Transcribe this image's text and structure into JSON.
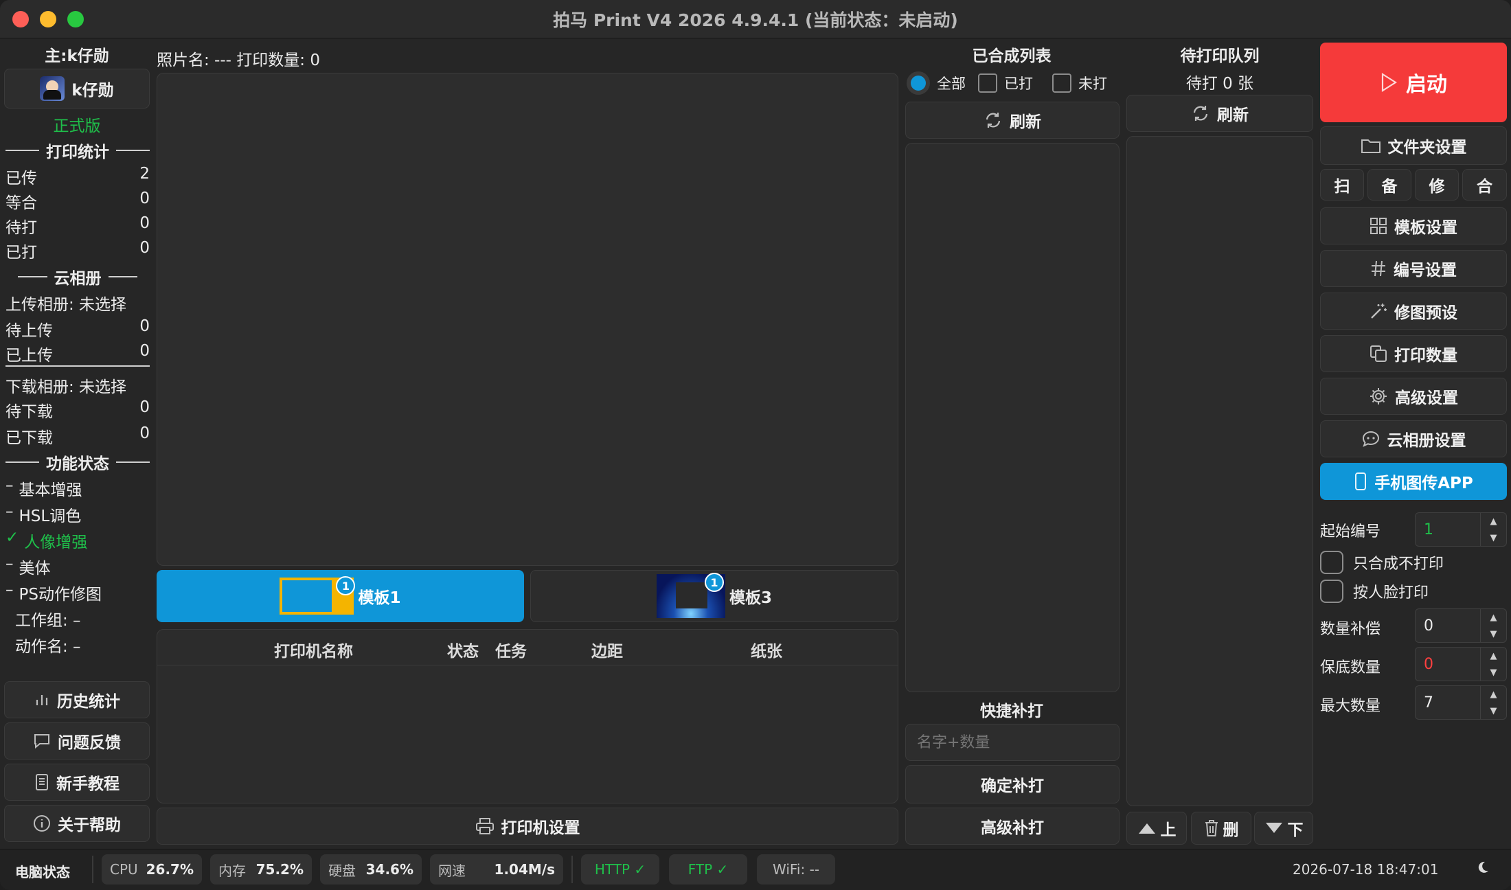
{
  "window": {
    "title": "拍马 Print V4 2026  4.9.4.1 (当前状态：未启动)"
  },
  "left": {
    "host": "主:k仔勋",
    "user_name": "k仔勋",
    "edition": "正式版",
    "print_stats_title": "打印统计",
    "print_stats": [
      {
        "label": "已传",
        "value": "2"
      },
      {
        "label": "等合",
        "value": "0"
      },
      {
        "label": "待打",
        "value": "0"
      },
      {
        "label": "已打",
        "value": "0"
      }
    ],
    "cloud_title": "云相册",
    "upload_album": "上传相册: 未选择",
    "upload_stats": [
      {
        "label": "待上传",
        "value": "0"
      },
      {
        "label": "已上传",
        "value": "0"
      }
    ],
    "download_album": "下载相册: 未选择",
    "download_stats": [
      {
        "label": "待下载",
        "value": "0"
      },
      {
        "label": "已下载",
        "value": "0"
      }
    ],
    "feature_title": "功能状态",
    "features": [
      {
        "prefix": "–",
        "label": "基本增强"
      },
      {
        "prefix": "–",
        "label": "HSL调色"
      },
      {
        "prefix": "✓",
        "label": "人像增强"
      },
      {
        "prefix": "–",
        "label": "美体"
      },
      {
        "prefix": "–",
        "label": "PS动作修图"
      }
    ],
    "workgroup": "工作组: –",
    "action_name": "动作名: –",
    "buttons": {
      "history": "历史统计",
      "feedback": "问题反馈",
      "tutorial": "新手教程",
      "help": "关于帮助"
    }
  },
  "center": {
    "photo_info": "照片名: --- 打印数量: 0",
    "templates": [
      {
        "label": "模板1",
        "badge": "1"
      },
      {
        "label": "模板3",
        "badge": "1"
      }
    ],
    "printer_columns": [
      "打印机名称",
      "状态",
      "任务",
      "边距",
      "纸张"
    ],
    "printer_settings": "打印机设置"
  },
  "composed": {
    "title": "已合成列表",
    "filters": [
      {
        "label": "全部",
        "selected": true
      },
      {
        "label": "已打",
        "selected": false
      },
      {
        "label": "未打",
        "selected": false
      }
    ],
    "refresh": "刷新",
    "quick_title": "快捷补打",
    "quick_placeholder": "名字+数量",
    "confirm": "确定补打",
    "advanced": "高级补打"
  },
  "queue": {
    "title": "待打印队列",
    "count": "待打 0 张",
    "refresh": "刷新",
    "up": "上",
    "delete": "删",
    "down": "下"
  },
  "right": {
    "start": "启动",
    "folder": "文件夹设置",
    "mini": [
      "扫",
      "备",
      "修",
      "合"
    ],
    "menu": [
      {
        "label": "模板设置",
        "icon": "grid-icon"
      },
      {
        "label": "编号设置",
        "icon": "hash-icon"
      },
      {
        "label": "修图预设",
        "icon": "magic-wand-icon"
      },
      {
        "label": "打印数量",
        "icon": "copies-icon"
      },
      {
        "label": "高级设置",
        "icon": "gear-icon"
      },
      {
        "label": "云相册设置",
        "icon": "cloud-chat-icon"
      }
    ],
    "app_button": "手机图传APP",
    "start_no_label": "起始编号",
    "start_no_value": "1",
    "only_compose": "只合成不打印",
    "face_print": "按人脸打印",
    "qty_comp_label": "数量补偿",
    "qty_comp_value": "0",
    "min_qty_label": "保底数量",
    "min_qty_value": "0",
    "max_qty_label": "最大数量",
    "max_qty_value": "7"
  },
  "status": {
    "label": "电脑状态",
    "cpu_label": "CPU",
    "cpu": "26.7%",
    "mem_label": "内存",
    "mem": "75.2%",
    "disk_label": "硬盘",
    "disk": "34.6%",
    "net_label": "网速",
    "net": "1.04M/s",
    "http": "HTTP ✓",
    "ftp": "FTP ✓",
    "wifi": "WiFi: --",
    "datetime": "2026-07-18 18:47:01"
  },
  "colors": {
    "accent": "#0f96d8",
    "start": "#f53a3a",
    "green": "#1fbf4a",
    "red_text": "#ff4040"
  }
}
